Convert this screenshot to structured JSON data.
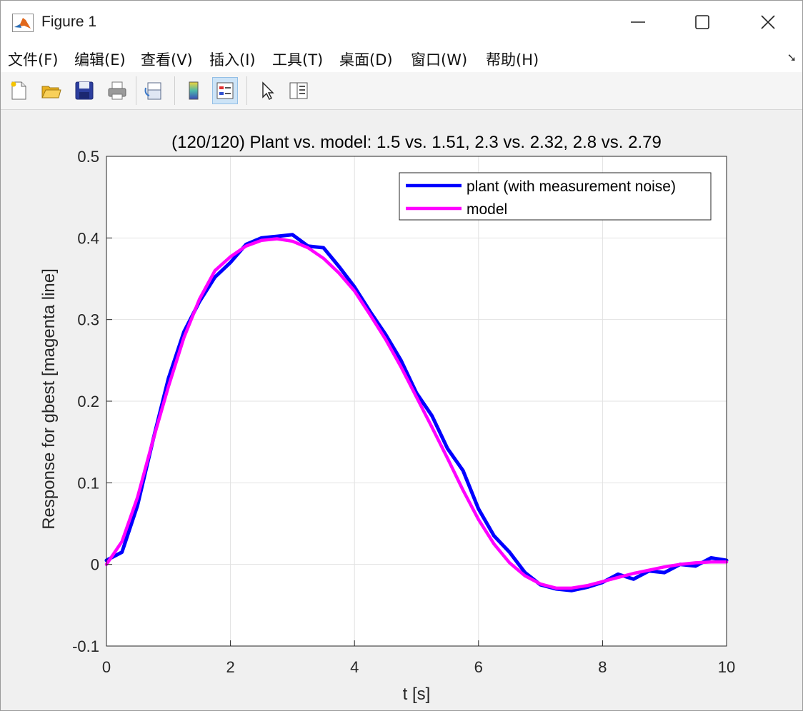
{
  "window": {
    "title": "Figure 1"
  },
  "menu": [
    "文件(F)",
    "编辑(E)",
    "查看(V)",
    "插入(I)",
    "工具(T)",
    "桌面(D)",
    "窗口(W)",
    "帮助(H)"
  ],
  "toolbar": [
    "new-figure-icon",
    "open-file-icon",
    "save-icon",
    "print-icon",
    "link-plot-icon",
    "colorbar-icon",
    "legend-icon",
    "pointer-icon",
    "property-inspector-icon"
  ],
  "chart_data": {
    "type": "line",
    "title": "(120/120) Plant vs. model: 1.5 vs. 1.51, 2.3 vs. 2.32, 2.8 vs. 2.79",
    "xlabel": "t [s]",
    "ylabel": "Response for gbest [magenta line]",
    "xlim": [
      0,
      10
    ],
    "ylim": [
      -0.1,
      0.5
    ],
    "xticks": [
      0,
      2,
      4,
      6,
      8,
      10
    ],
    "yticks": [
      -0.1,
      0,
      0.1,
      0.2,
      0.3,
      0.4,
      0.5
    ],
    "xtick_labels": [
      "0",
      "2",
      "4",
      "6",
      "8",
      "10"
    ],
    "ytick_labels": [
      "-0.1",
      "0",
      "0.1",
      "0.2",
      "0.3",
      "0.4",
      "0.5"
    ],
    "grid": true,
    "legend_position": "top-right",
    "series": [
      {
        "name": "plant (with measurement noise)",
        "color": "#0000ff",
        "x": [
          0,
          0.25,
          0.5,
          0.75,
          1.0,
          1.25,
          1.5,
          1.75,
          2.0,
          2.25,
          2.5,
          2.75,
          3.0,
          3.25,
          3.5,
          3.75,
          4.0,
          4.25,
          4.5,
          4.75,
          5.0,
          5.25,
          5.5,
          5.75,
          6.0,
          6.25,
          6.5,
          6.75,
          7.0,
          7.25,
          7.5,
          7.75,
          8.0,
          8.25,
          8.5,
          8.75,
          9.0,
          9.25,
          9.5,
          9.75,
          10.0
        ],
        "y": [
          0.005,
          0.015,
          0.072,
          0.152,
          0.228,
          0.285,
          0.322,
          0.352,
          0.37,
          0.392,
          0.4,
          0.402,
          0.404,
          0.39,
          0.388,
          0.365,
          0.34,
          0.31,
          0.282,
          0.25,
          0.21,
          0.182,
          0.142,
          0.115,
          0.068,
          0.035,
          0.015,
          -0.01,
          -0.025,
          -0.03,
          -0.032,
          -0.028,
          -0.022,
          -0.012,
          -0.018,
          -0.008,
          -0.01,
          0.0,
          -0.002,
          0.008,
          0.005
        ]
      },
      {
        "name": "model",
        "color": "#ff00ff",
        "x": [
          0,
          0.25,
          0.5,
          0.75,
          1.0,
          1.25,
          1.5,
          1.75,
          2.0,
          2.25,
          2.5,
          2.75,
          3.0,
          3.25,
          3.5,
          3.75,
          4.0,
          4.25,
          4.5,
          4.75,
          5.0,
          5.25,
          5.5,
          5.75,
          6.0,
          6.25,
          6.5,
          6.75,
          7.0,
          7.25,
          7.5,
          7.75,
          8.0,
          8.25,
          8.5,
          8.75,
          9.0,
          9.25,
          9.5,
          9.75,
          10.0
        ],
        "y": [
          0.0,
          0.028,
          0.082,
          0.152,
          0.218,
          0.278,
          0.325,
          0.36,
          0.377,
          0.39,
          0.397,
          0.399,
          0.396,
          0.388,
          0.375,
          0.357,
          0.335,
          0.306,
          0.276,
          0.242,
          0.205,
          0.168,
          0.13,
          0.091,
          0.055,
          0.025,
          0.002,
          -0.014,
          -0.024,
          -0.029,
          -0.029,
          -0.026,
          -0.021,
          -0.016,
          -0.011,
          -0.007,
          -0.003,
          0.0,
          0.002,
          0.003,
          0.003
        ]
      }
    ]
  }
}
